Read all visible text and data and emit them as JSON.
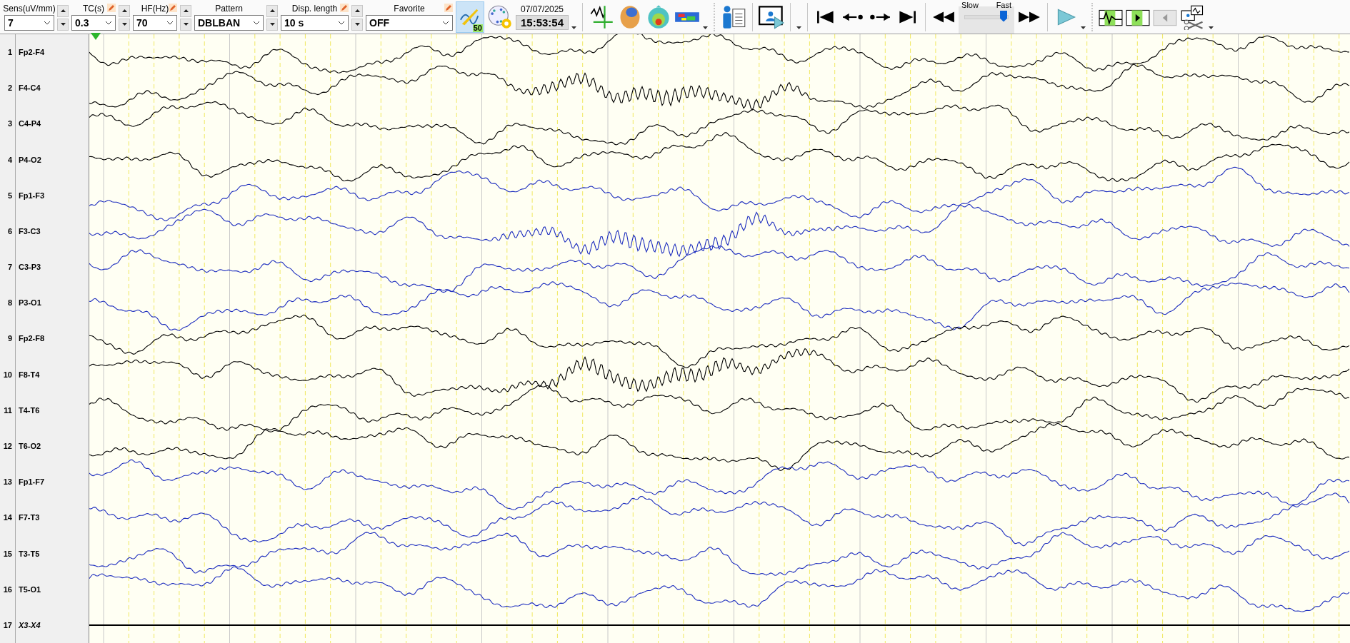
{
  "toolbar": {
    "selectors": [
      {
        "label": "Sens(uV/mm)",
        "value": "7",
        "editable": false,
        "spinner": true
      },
      {
        "label": "TC(s)",
        "value": "0.3",
        "editable": true,
        "spinner": true
      },
      {
        "label": "HF(Hz)",
        "value": "70",
        "editable": true,
        "spinner": true
      },
      {
        "label": "Pattern",
        "value": "DBLBAN",
        "editable": false,
        "spinner": true
      },
      {
        "label": "Disp. length",
        "value": "10 s",
        "editable": true,
        "spinner": true
      },
      {
        "label": "Favorite",
        "value": "OFF",
        "editable": true,
        "spinner": false
      }
    ],
    "annotate": {
      "selected": true,
      "badge": "50"
    },
    "date": "07/07/2025",
    "time": "15:53:54",
    "speed": {
      "slow": "Slow",
      "fast": "Fast",
      "level": 0.9
    },
    "segment_back": {
      "disabled": true
    }
  },
  "channels": [
    {
      "number": "1",
      "name": "Fp2-F4",
      "kind": "trace",
      "color": "#000000"
    },
    {
      "number": "2",
      "name": "F4-C4",
      "kind": "trace",
      "color": "#000000"
    },
    {
      "number": "3",
      "name": "C4-P4",
      "kind": "trace",
      "color": "#000000"
    },
    {
      "number": "4",
      "name": "P4-O2",
      "kind": "trace",
      "color": "#000000"
    },
    {
      "number": "5",
      "name": "Fp1-F3",
      "kind": "trace",
      "color": "#1f2fbf"
    },
    {
      "number": "6",
      "name": "F3-C3",
      "kind": "trace",
      "color": "#1f2fbf"
    },
    {
      "number": "7",
      "name": "C3-P3",
      "kind": "trace",
      "color": "#1f2fbf"
    },
    {
      "number": "8",
      "name": "P3-O1",
      "kind": "trace",
      "color": "#1f2fbf"
    },
    {
      "number": "9",
      "name": "Fp2-F8",
      "kind": "trace",
      "color": "#000000"
    },
    {
      "number": "10",
      "name": "F8-T4",
      "kind": "trace",
      "color": "#000000"
    },
    {
      "number": "11",
      "name": "T4-T6",
      "kind": "trace",
      "color": "#000000"
    },
    {
      "number": "12",
      "name": "T6-O2",
      "kind": "trace",
      "color": "#000000"
    },
    {
      "number": "13",
      "name": "Fp1-F7",
      "kind": "trace",
      "color": "#1f2fbf"
    },
    {
      "number": "14",
      "name": "F7-T3",
      "kind": "trace",
      "color": "#1f2fbf"
    },
    {
      "number": "15",
      "name": "T3-T5",
      "kind": "trace",
      "color": "#1f2fbf"
    },
    {
      "number": "16",
      "name": "T5-O1",
      "kind": "trace",
      "color": "#1f2fbf"
    },
    {
      "number": "17",
      "name": "X3-X4",
      "kind": "flat",
      "color": "#000000"
    }
  ]
}
